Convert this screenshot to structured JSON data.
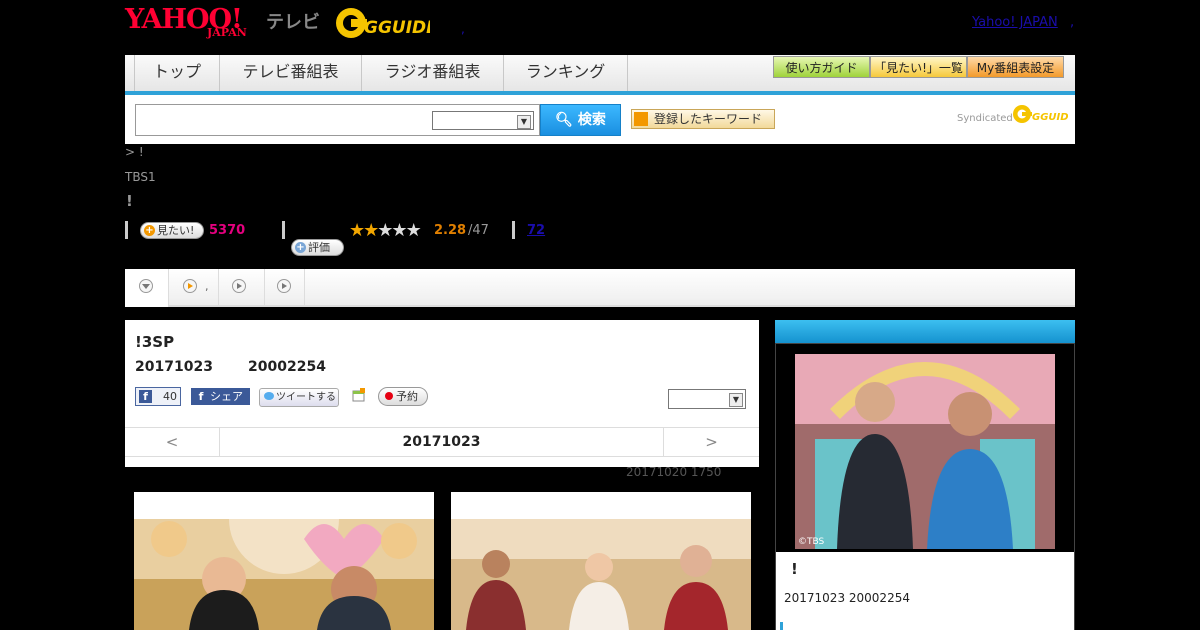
{
  "header": {
    "logo_yahoo": "YAHOO!",
    "logo_japan": "JAPAN",
    "logo_tv": "テレビ",
    "logo_gguide": "GGUIDE",
    "yahoo_japan_link": "Yahoo! JAPAN",
    "link_dot": ",",
    "small_dot": ","
  },
  "nav": {
    "items": [
      "トップ",
      "テレビ番組表",
      "ラジオ番組表",
      "ランキング"
    ],
    "guide_buttons": [
      "使い方ガイド",
      "「見たい!」一覧",
      "My番組表設定"
    ]
  },
  "search": {
    "placeholder": "",
    "category_value": "",
    "button_label": "検索",
    "keyword_button": "登録したキーワード",
    "syndicated": "Syndicated",
    "syndicated_logo": "GGUIDE"
  },
  "program": {
    "breadcrumb": "> !",
    "station": "TBS1",
    "title_mark": "!",
    "mitai_label": "見たい!",
    "mitai_count": "5370",
    "rating_label": "評価",
    "rating_stars": 2.28,
    "rating_score": "2.28",
    "rating_total": "/47",
    "review_link": "72"
  },
  "tabs": [
    "",
    ",",
    "",
    ""
  ],
  "episode": {
    "title": "!3SP",
    "date": "20171023",
    "time": "20002254",
    "fb_count": "40",
    "fb_share": "シェア",
    "tweet": "ツイートする",
    "reserve": "予約",
    "select_value": "",
    "prev": "<",
    "next": ">",
    "date_nav": "20171023",
    "update": "20171020  1750"
  },
  "side": {
    "title_mark": "!",
    "date_time": "20171023  20002254",
    "copyright": "©TBS"
  },
  "colors": {
    "accent": "#2fa2d8",
    "yahoo_red": "#ff0033",
    "mitai_pink": "#e4007f",
    "star": "#f3a700"
  }
}
